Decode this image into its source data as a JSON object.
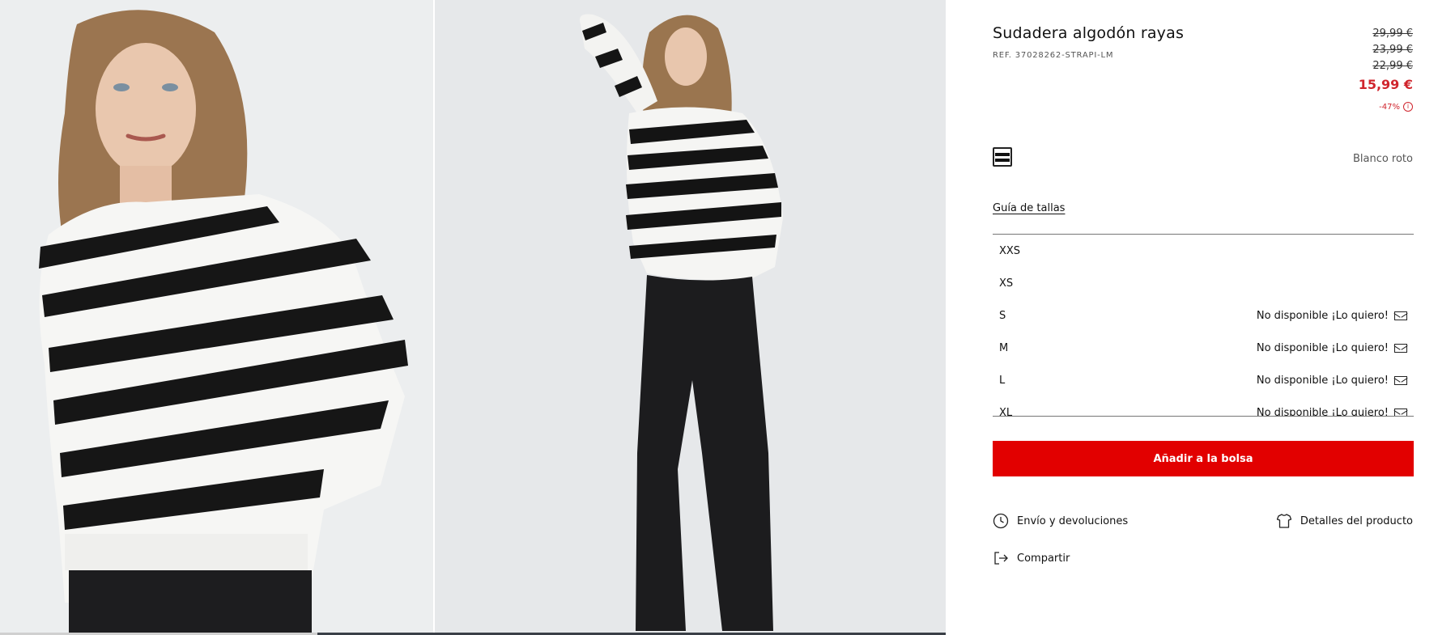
{
  "gallery": {
    "images": [
      {
        "alt": "Modelo con sudadera de rayas, primer plano"
      },
      {
        "alt": "Modelo con sudadera de rayas y pantalón negro, cuerpo entero"
      }
    ]
  },
  "product": {
    "title": "Sudadera algodón rayas",
    "ref": "REF. 37028262-STRAPI-LM",
    "prices_old": [
      "29,99 €",
      "23,99 €",
      "22,99 €"
    ],
    "price_current": "15,99 €",
    "discount": "-47%",
    "color_name": "Blanco roto",
    "size_guide": "Guía de tallas",
    "sizes": [
      {
        "label": "XXS",
        "status": ""
      },
      {
        "label": "XS",
        "status": ""
      },
      {
        "label": "S",
        "status": "No disponible ¡Lo quiero!"
      },
      {
        "label": "M",
        "status": "No disponible ¡Lo quiero!"
      },
      {
        "label": "L",
        "status": "No disponible ¡Lo quiero!"
      },
      {
        "label": "XL",
        "status": "No disponible ¡Lo quiero!"
      }
    ],
    "add_to_bag": "Añadir a la bolsa",
    "links": {
      "shipping": "Envío y devoluciones",
      "details": "Detalles del producto",
      "share": "Compartir"
    }
  },
  "colors": {
    "sale_red": "#d0252d",
    "button_red": "#e20000"
  },
  "icons": {
    "info": "info-icon",
    "mail": "mail-icon",
    "clock": "clock-icon",
    "tshirt": "tshirt-icon",
    "share": "share-icon"
  }
}
